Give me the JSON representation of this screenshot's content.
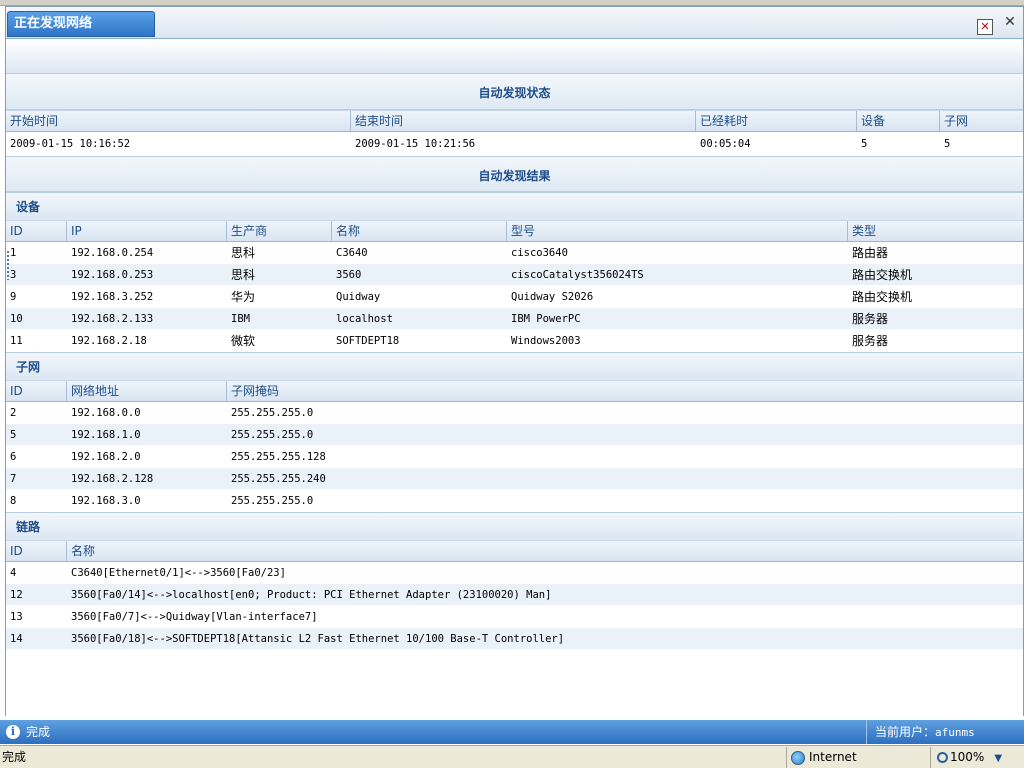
{
  "window": {
    "tab_title": "正在发现网络",
    "tab_close_glyph": "✕",
    "close_glyph": "✕"
  },
  "status_section": {
    "title": "自动发现状态",
    "headers": [
      "开始时间",
      "结束时间",
      "已经耗时",
      "设备",
      "子网"
    ],
    "row": [
      "2009-01-15 10:16:52",
      "2009-01-15 10:21:56",
      "00:05:04",
      "5",
      "5"
    ]
  },
  "result_section": {
    "title": "自动发现结果"
  },
  "devices": {
    "title": "设备",
    "headers": [
      "ID",
      "IP",
      "生产商",
      "名称",
      "型号",
      "类型"
    ],
    "rows": [
      [
        "1",
        "192.168.0.254",
        "思科",
        "C3640",
        "cisco3640",
        "路由器"
      ],
      [
        "3",
        "192.168.0.253",
        "思科",
        "3560",
        "ciscoCatalyst356024TS",
        "路由交换机"
      ],
      [
        "9",
        "192.168.3.252",
        "华为",
        "Quidway",
        "Quidway S2026",
        "路由交换机"
      ],
      [
        "10",
        "192.168.2.133",
        "IBM",
        "localhost",
        "IBM PowerPC",
        "服务器"
      ],
      [
        "11",
        "192.168.2.18",
        "微软",
        "SOFTDEPT18",
        "Windows2003",
        "服务器"
      ]
    ]
  },
  "subnets": {
    "title": "子网",
    "headers": [
      "ID",
      "网络地址",
      "子网掩码"
    ],
    "rows": [
      [
        "2",
        "192.168.0.0",
        "255.255.255.0"
      ],
      [
        "5",
        "192.168.1.0",
        "255.255.255.0"
      ],
      [
        "6",
        "192.168.2.0",
        "255.255.255.128"
      ],
      [
        "7",
        "192.168.2.128",
        "255.255.255.240"
      ],
      [
        "8",
        "192.168.3.0",
        "255.255.255.0"
      ]
    ]
  },
  "links": {
    "title": "链路",
    "headers": [
      "ID",
      "名称"
    ],
    "rows": [
      [
        "4",
        "C3640[Ethernet0/1]<-->3560[Fa0/23]"
      ],
      [
        "12",
        "3560[Fa0/14]<-->localhost[en0; Product: PCI Ethernet Adapter (23100020) Man]"
      ],
      [
        "13",
        "3560[Fa0/7]<-->Quidway[Vlan-interface7]"
      ],
      [
        "14",
        "3560[Fa0/18]<-->SOFTDEPT18[Attansic L2 Fast Ethernet 10/100 Base-T Controller]"
      ]
    ]
  },
  "app_status": {
    "info_glyph": "i",
    "done": "完成",
    "user_label": "当前用户：",
    "user_name": "afunms"
  },
  "browser_status": {
    "text": "完成",
    "zone": "Internet",
    "zoom": "100%",
    "zoom_dropdown_glyph": "▼"
  }
}
